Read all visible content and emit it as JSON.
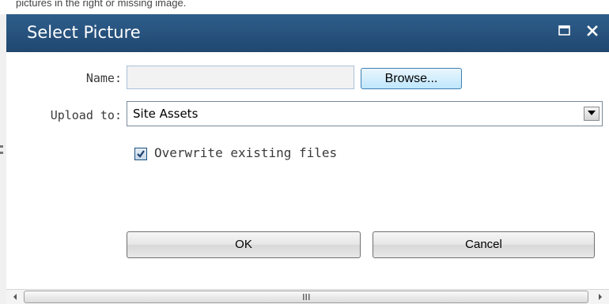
{
  "background": {
    "caption": "pictures in the right or missing image.",
    "colors": {
      "strip": "#ffffff",
      "page": "#f0f0f0"
    }
  },
  "dialog": {
    "title": "Select Picture",
    "title_icons": [
      "maximize-icon",
      "close-icon"
    ],
    "colors": {
      "titlebar": "#2a5782",
      "title_text": "#ffffff",
      "body": "#ffffff",
      "label_text": "#3a3a3a",
      "browse_accent": "#3c7fb1"
    },
    "fields": {
      "name": {
        "label": "Name:",
        "value": "",
        "placeholder": "",
        "browse_label": "Browse..."
      },
      "upload_to": {
        "label": "Upload to:",
        "selected": "Site Assets",
        "icon": "chevron-down-icon"
      },
      "overwrite": {
        "label": "Overwrite existing files",
        "checked": true
      }
    },
    "buttons": {
      "ok": "OK",
      "cancel": "Cancel"
    },
    "scrollbar": {
      "left_icon": "arrow-left-icon",
      "right_icon": "arrow-right-icon",
      "grip_icon": "grip-icon"
    }
  }
}
